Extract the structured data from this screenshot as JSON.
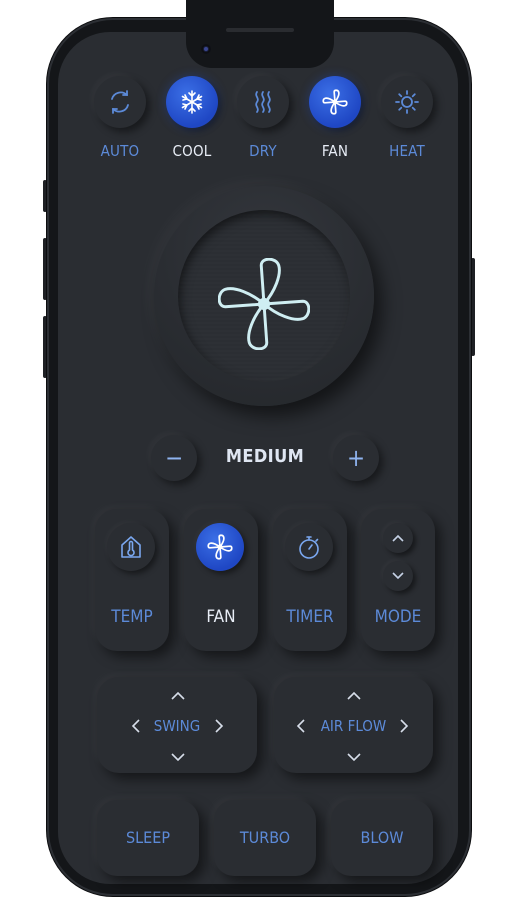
{
  "modes": [
    {
      "label": "AUTO",
      "icon": "auto-cycle-icon",
      "active": false
    },
    {
      "label": "COOL",
      "icon": "snowflake-icon",
      "active": true
    },
    {
      "label": "DRY",
      "icon": "dry-waves-icon",
      "active": false
    },
    {
      "label": "FAN",
      "icon": "fan-icon",
      "active": true
    },
    {
      "label": "HEAT",
      "icon": "sun-icon",
      "active": false
    }
  ],
  "fan_speed": {
    "label": "MEDIUM",
    "decrease": "−",
    "increase": "+"
  },
  "controls": [
    {
      "label": "TEMP",
      "icon": "thermometer-home-icon",
      "active": false
    },
    {
      "label": "FAN",
      "icon": "fan-icon",
      "active": true
    },
    {
      "label": "TIMER",
      "icon": "stopwatch-icon",
      "active": false
    },
    {
      "label": "MODE",
      "icon": "chevron-up-down-icon",
      "active": false
    }
  ],
  "pads": [
    {
      "label": "SWING"
    },
    {
      "label": "AIR FLOW"
    }
  ],
  "bottom": [
    {
      "label": "SLEEP"
    },
    {
      "label": "TURBO"
    },
    {
      "label": "BLOW"
    }
  ],
  "colors": {
    "accent": "#2f5fdc",
    "label": "#5c8ad8",
    "background": "#2a2d32"
  }
}
